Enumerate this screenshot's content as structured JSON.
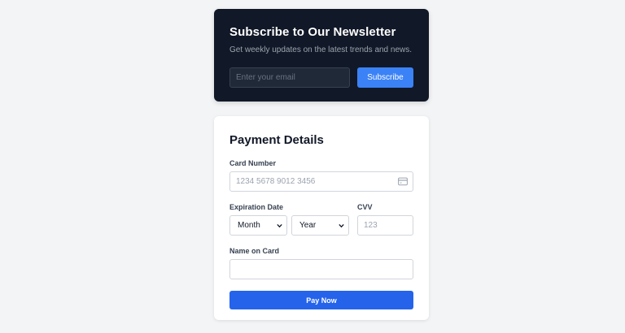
{
  "newsletter": {
    "title": "Subscribe to Our Newsletter",
    "subtitle": "Get weekly updates on the latest trends and news.",
    "email_placeholder": "Enter your email",
    "subscribe_label": "Subscribe"
  },
  "payment": {
    "title": "Payment Details",
    "card_number_label": "Card Number",
    "card_number_placeholder": "1234 5678 9012 3456",
    "card_icon": "credit-card-icon",
    "expiration_label": "Expiration Date",
    "month_value": "Month",
    "year_value": "Year",
    "cvv_label": "CVV",
    "cvv_placeholder": "123",
    "name_label": "Name on Card",
    "name_placeholder": "",
    "pay_label": "Pay Now"
  },
  "colors": {
    "newsletter_bg": "#111827",
    "accent_blue": "#3b82f6",
    "pay_blue": "#2563eb",
    "page_bg": "#f3f4f6"
  }
}
